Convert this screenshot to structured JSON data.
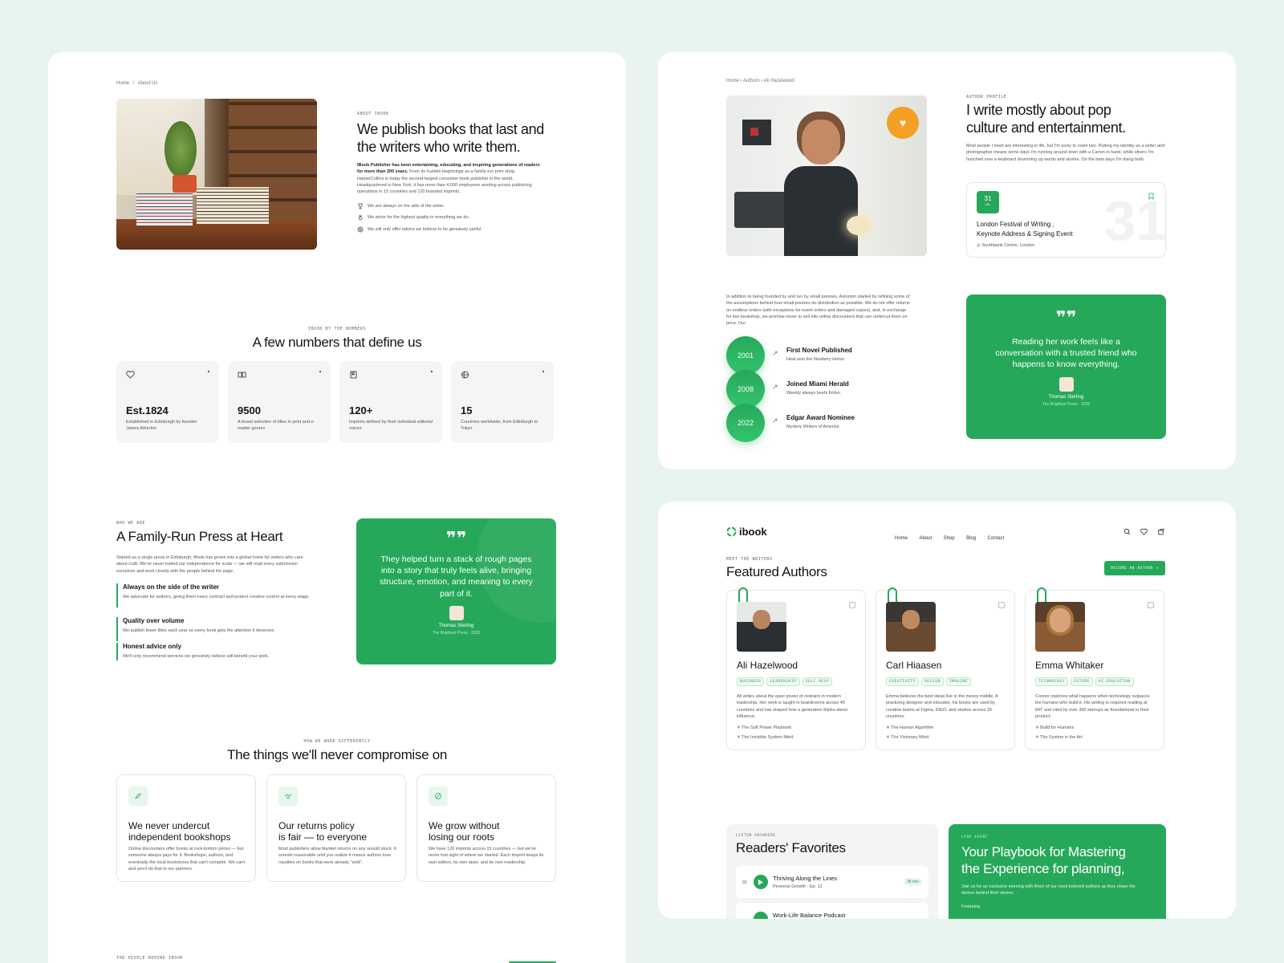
{
  "about_page": {
    "breadcrumb": {
      "home": "Home",
      "sep": "/",
      "current": "About Us"
    },
    "hero": {
      "eyebrow": "ABOUT IBOOK",
      "title_line1": "We publish books that last and",
      "title_line2": "the writers who write them.",
      "body_bold": "iBook Publisher has been entertaining, educating, and inspiring generations of readers for more than 200 years.",
      "body": "From its humble beginnings as a family-run print shop, HarperCollins is today the second-largest consumer book publisher in the world. Headquartered in New York, it has more than 4,000 employees working across publishing operations in 15 countries and 120 branded imprints.",
      "bullets": [
        "We are always on the side of the writer.",
        "We strive for the highest quality in everything we do.",
        "We will only offer advice we believe to be genuinely useful."
      ]
    },
    "numbers": {
      "eyebrow": "IBOOK BY THE NUMBERS",
      "title": "A few numbers that define us",
      "stats": [
        {
          "icon": "heart-icon",
          "value": "Est.1824",
          "desc": "Established in Edinburgh by founder James Atherton"
        },
        {
          "icon": "book-open-icon",
          "value": "9500",
          "desc": "A broad selection of titles in print and e-reader genres"
        },
        {
          "icon": "bookmark-book-icon",
          "value": "120+",
          "desc": "Imprints defined by their individual editorial voices"
        },
        {
          "icon": "globe-icon",
          "value": "15",
          "desc": "Countries worldwide, from Edinburgh to Tokyo"
        }
      ]
    },
    "who": {
      "eyebrow": "WHO WE ARE",
      "title": "A Family-Run Press at Heart",
      "body": "Started as a single press in Edinburgh, iBook has grown into a global home for writers who care about craft. We've never traded our independence for scale — we still read every submission ourselves and work closely with the people behind the page.",
      "points": [
        {
          "title": "Always on the side of the writer",
          "desc": "We advocate for authors, giving them every contract and protect creative control at every stage."
        },
        {
          "title": "Quality over volume",
          "desc": "We publish fewer titles each year so every book gets the attention it deserves."
        },
        {
          "title": "Honest advice only",
          "desc": "We'll only recommend services we genuinely believe will benefit your work."
        }
      ],
      "quote": "They helped turn a stack of rough pages into a story that truly feels alive, bringing structure, emotion, and meaning to every part of it.",
      "quote_author": "Thomas Sterling",
      "quote_role": "The Brightest Press · 2025"
    },
    "values": {
      "eyebrow": "HOW WE WORK DIFFERENTLY",
      "title": "The things we'll never compromise on",
      "items": [
        {
          "title_line1": "We never undercut",
          "title_line2": "independent bookshops",
          "desc": "Online discounters offer books at rock-bottom prices — but someone always pays for it. Bookshops, authors, and eventually the local bookstores that can't compete. We can't and won't do that to our partners."
        },
        {
          "title_line1": "Our returns policy",
          "title_line2": "is fair — to everyone",
          "desc": "Most publishers allow blanket returns on any unsold stock. It sounds reasonable until you realize it means authors lose royalties on books that were already \"sold\"."
        },
        {
          "title_line1": "We grow without",
          "title_line2": "losing our roots",
          "desc": "We have 120 imprints across 15 countries — but we've never lost sight of where we started. Each imprint keeps its own editors, its own taste, and its own readership."
        }
      ]
    },
    "footer_eyebrow": "THE PEOPLE BEHIND IBOOK"
  },
  "author_page": {
    "breadcrumb": {
      "home": "Home",
      "mid": "Authors",
      "current": "Ali Hazelwood"
    },
    "eyebrow": "AUTHOR PROFILE",
    "title_line1": "I write mostly about pop",
    "title_line2": "culture and entertainment.",
    "body": "Most people I meet are interesting in life, but I'm lucky to claim two. Putting my identity as a writer and photographer means some days I'm running around town with a Canon in hand, while others I'm hunched over a keyboard drumming up words and stories. On the best days I'm doing both.",
    "event": {
      "day": "31",
      "month": "JUL",
      "title_line1": "London Festival of Writing ,",
      "title_line2": "Keynote Address & Signing Event",
      "location": "Southbank Centre, London",
      "big_number": "31"
    },
    "bio": "In addition to being founded by and run by small presses, Astorism started by refining some of the assumptions behind how small presses do distribution as possible. We do not offer returns on endless orders (with exceptions for event orders and damaged copies), and, in exchange for low bookshop, we promise never to sell into online discounters that can undercut them on price. Our",
    "timeline": [
      {
        "year": "2001",
        "title": "First Novel Published",
        "sub": "Heat won the Newbery Honor"
      },
      {
        "year": "2008",
        "title": "Joined Miami Herald",
        "sub": "Weekly always beefs fiction"
      },
      {
        "year": "2022",
        "title": "Edgar Award Nominee",
        "sub": "Mystery Writers of America"
      }
    ],
    "quote": "Reading her work feels like a conversation with a trusted friend who happens to know everything.",
    "quote_author": "Thomas Sterling",
    "quote_role": "The Brightest Press · 2025"
  },
  "home_page": {
    "logo": "ibook",
    "nav": [
      "Home",
      "About",
      "Shop",
      "Blog",
      "Contact"
    ],
    "eyebrow": "MEET THE WRITERS",
    "title": "Featured Authors",
    "cta": "BECOME AN AUTHOR",
    "authors": [
      {
        "name": "Ali Hazelwood",
        "tags": [
          "BUSINESS",
          "LEADERSHIP",
          "SELF HELP"
        ],
        "desc": "Ali writes about the quiet power of restraint in modern leadership. Her work is taught in boardrooms across 40 countries and has shaped how a generation thinks about influence.",
        "books": [
          "The Soft Power Playbook",
          "The Invisible System Mind"
        ]
      },
      {
        "name": "Carl Hiaasen",
        "tags": [
          "CREATIVITY",
          "DESIGN",
          "IMAGINE"
        ],
        "desc": "Emma believes the best ideas live in the messy middle. A practicing designer and educator, his books are used by creative teams at Figma, IDEO, and studios across 18 countries.",
        "books": [
          "The Human Algorithm",
          "The Visionary Mind"
        ]
      },
      {
        "name": "Emma Whitaker",
        "tags": [
          "TECHNOLOGY",
          "FUTURE",
          "AI EDUCATION"
        ],
        "desc": "Connor explores what happens when technology outpaces the humans who build it. His writing is required reading at MIT and cited by over 300 startups as foundational to their product.",
        "books": [
          "Build for Humans",
          "The System in the Art"
        ]
      }
    ],
    "favorites": {
      "eyebrow": "LISTEN ANYWHERE",
      "title": "Readers' Favorites",
      "tracks": [
        {
          "num": "01",
          "title": "Thriving Along the Lines",
          "sub": "Personal Growth · Ep. 12",
          "duration": "38 min"
        },
        {
          "num": "02",
          "title": "Work-Life Balance Podcast",
          "sub": "",
          "duration": ""
        }
      ]
    },
    "event": {
      "eyebrow": "LIVE EVENT",
      "title_line1": "Your Playbook for Mastering",
      "title_line2": "the Experience for planning,",
      "body": "Join us for an exclusive evening with three of our most beloved authors as they share the stories behind their stories.",
      "featuring": "Featuring"
    }
  },
  "colors": {
    "accent": "#26a85a",
    "background": "#e8f4ee"
  }
}
